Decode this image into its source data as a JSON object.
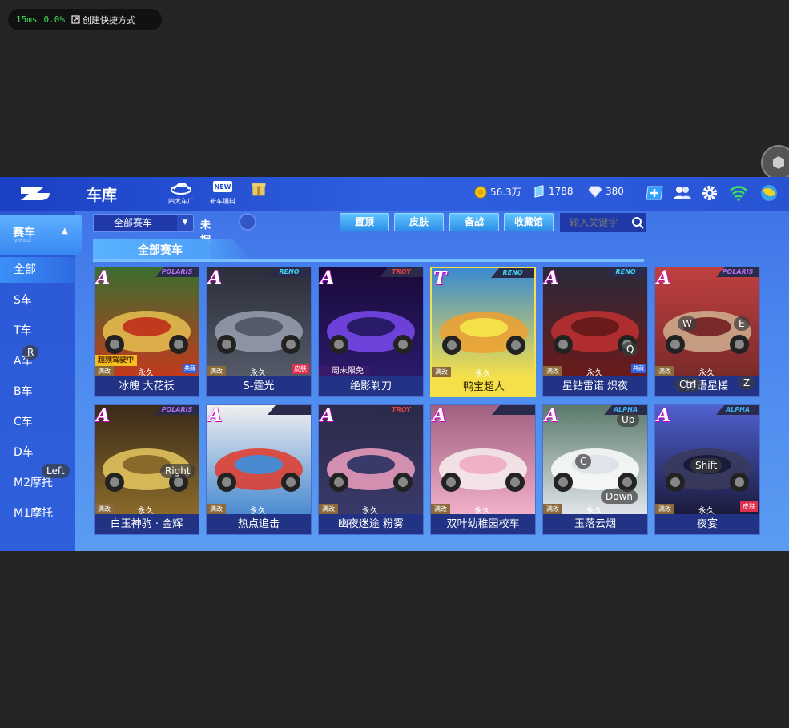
{
  "overlay": {
    "latency": "15ms",
    "loss": "0.0%",
    "shortcut_label": "创建快捷方式"
  },
  "header": {
    "title": "车库",
    "icons": [
      {
        "label": "四大车厂",
        "icon": "car-factory-icon"
      },
      {
        "label": "新车爆料",
        "icon": "new-car-icon"
      },
      {
        "label": "",
        "icon": "gift-icon"
      }
    ],
    "resources": {
      "coins": "56.3万",
      "points": "1788",
      "diamonds": "380"
    }
  },
  "sidebar": {
    "category": "赛车",
    "category_sub": "VEHICLE",
    "items": [
      "全部",
      "S车",
      "T车",
      "A车",
      "B车",
      "C车",
      "D车",
      "M2摩托",
      "M1摩托"
    ],
    "active_index": 0
  },
  "filters": {
    "dropdown": "全部赛车",
    "unowned_label": "未拥有",
    "buttons": [
      "置顶",
      "皮肤",
      "备战",
      "收藏馆"
    ],
    "search_placeholder": "输入关键字"
  },
  "section_title": "全部赛车",
  "cards": [
    {
      "rank": "A",
      "brand": "POLARIS",
      "name": "冰魄 大花袄",
      "tag": "满改",
      "duration": "永久",
      "promo": "超频驾驶中",
      "extra": "典藏"
    },
    {
      "rank": "A",
      "brand": "RENO",
      "name": "S-霆光",
      "tag": "满改",
      "duration": "永久",
      "extra": "皮肤"
    },
    {
      "rank": "A",
      "brand": "TROY",
      "name": "绝影剃刀",
      "tag": "满改",
      "duration": "",
      "promo2": "周末限免"
    },
    {
      "rank": "T",
      "brand": "RENO",
      "name": "鸭宝超人",
      "tag": "满改",
      "duration": "永久"
    },
    {
      "rank": "A",
      "brand": "RENO",
      "name": "星钻雷诺 炽夜",
      "tag": "满改",
      "duration": "永久",
      "extra": "典藏"
    },
    {
      "rank": "A",
      "brand": "POLARIS",
      "name": "芳语星槎",
      "tag": "满改",
      "duration": "永久"
    },
    {
      "rank": "A",
      "brand": "POLARIS",
      "name": "白玉神驹 · 金辉",
      "tag": "满改",
      "duration": "永久"
    },
    {
      "rank": "A",
      "brand": "",
      "name": "热点追击",
      "tag": "满改",
      "duration": "永久"
    },
    {
      "rank": "A",
      "brand": "TROY",
      "name": "幽夜迷途 粉雾",
      "tag": "满改",
      "duration": "永久"
    },
    {
      "rank": "A",
      "brand": "",
      "name": "双叶幼稚园校车",
      "tag": "满改",
      "duration": "永久"
    },
    {
      "rank": "A",
      "brand": "ALPHA",
      "name": "玉落云烟",
      "tag": "满改",
      "duration": "永久"
    },
    {
      "rank": "A",
      "brand": "ALPHA",
      "name": "夜宴",
      "tag": "满改",
      "duration": "永久",
      "extra": "皮肤"
    }
  ],
  "key_hints": [
    "R",
    "Left",
    "Right",
    "W",
    "E",
    "Q",
    "Ctrl",
    "Z",
    "Up",
    "C",
    "Shift",
    "Down"
  ]
}
